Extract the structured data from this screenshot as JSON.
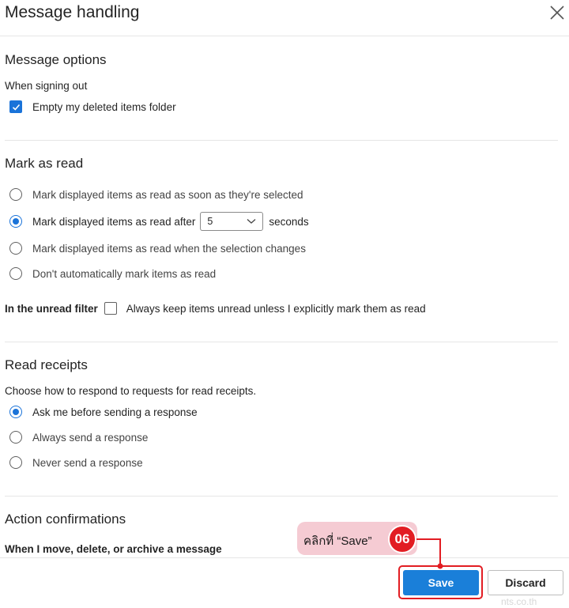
{
  "dialog": {
    "title": "Message handling",
    "close_icon": "close-icon"
  },
  "message_options": {
    "heading": "Message options",
    "signing_out_label": "When signing out",
    "empty_deleted_label": "Empty my deleted items folder",
    "empty_deleted_checked": true
  },
  "mark_as_read": {
    "heading": "Mark as read",
    "options": [
      {
        "label": "Mark displayed items as read as soon as they're selected",
        "selected": false
      },
      {
        "label": "Mark displayed items as read after",
        "selected": true
      },
      {
        "label": "Mark displayed items as read when the selection changes",
        "selected": false
      },
      {
        "label": "Don't automatically mark items as read",
        "selected": false
      }
    ],
    "delay_value": "5",
    "delay_unit": "seconds",
    "unread_filter_label": "In the unread filter",
    "unread_filter_checkbox_label": "Always keep items unread unless I explicitly mark them as read",
    "unread_filter_checked": false
  },
  "read_receipts": {
    "heading": "Read receipts",
    "description": "Choose how to respond to requests for read receipts.",
    "options": [
      {
        "label": "Ask me before sending a response",
        "selected": true
      },
      {
        "label": "Always send a response",
        "selected": false
      },
      {
        "label": "Never send a response",
        "selected": false
      }
    ]
  },
  "action_confirmations": {
    "heading": "Action confirmations",
    "sub_label": "When I move, delete, or archive a message"
  },
  "footer": {
    "save_label": "Save",
    "discard_label": "Discard"
  },
  "annotation": {
    "callout_text": "คลิกที่ “Save”",
    "step_number": "06",
    "highlight_color": "#e21d23",
    "callout_color": "#f5cbd3"
  },
  "watermark": "nts.co.th",
  "colors": {
    "accent": "#1a73d9",
    "save_button": "#1a7fd9"
  }
}
